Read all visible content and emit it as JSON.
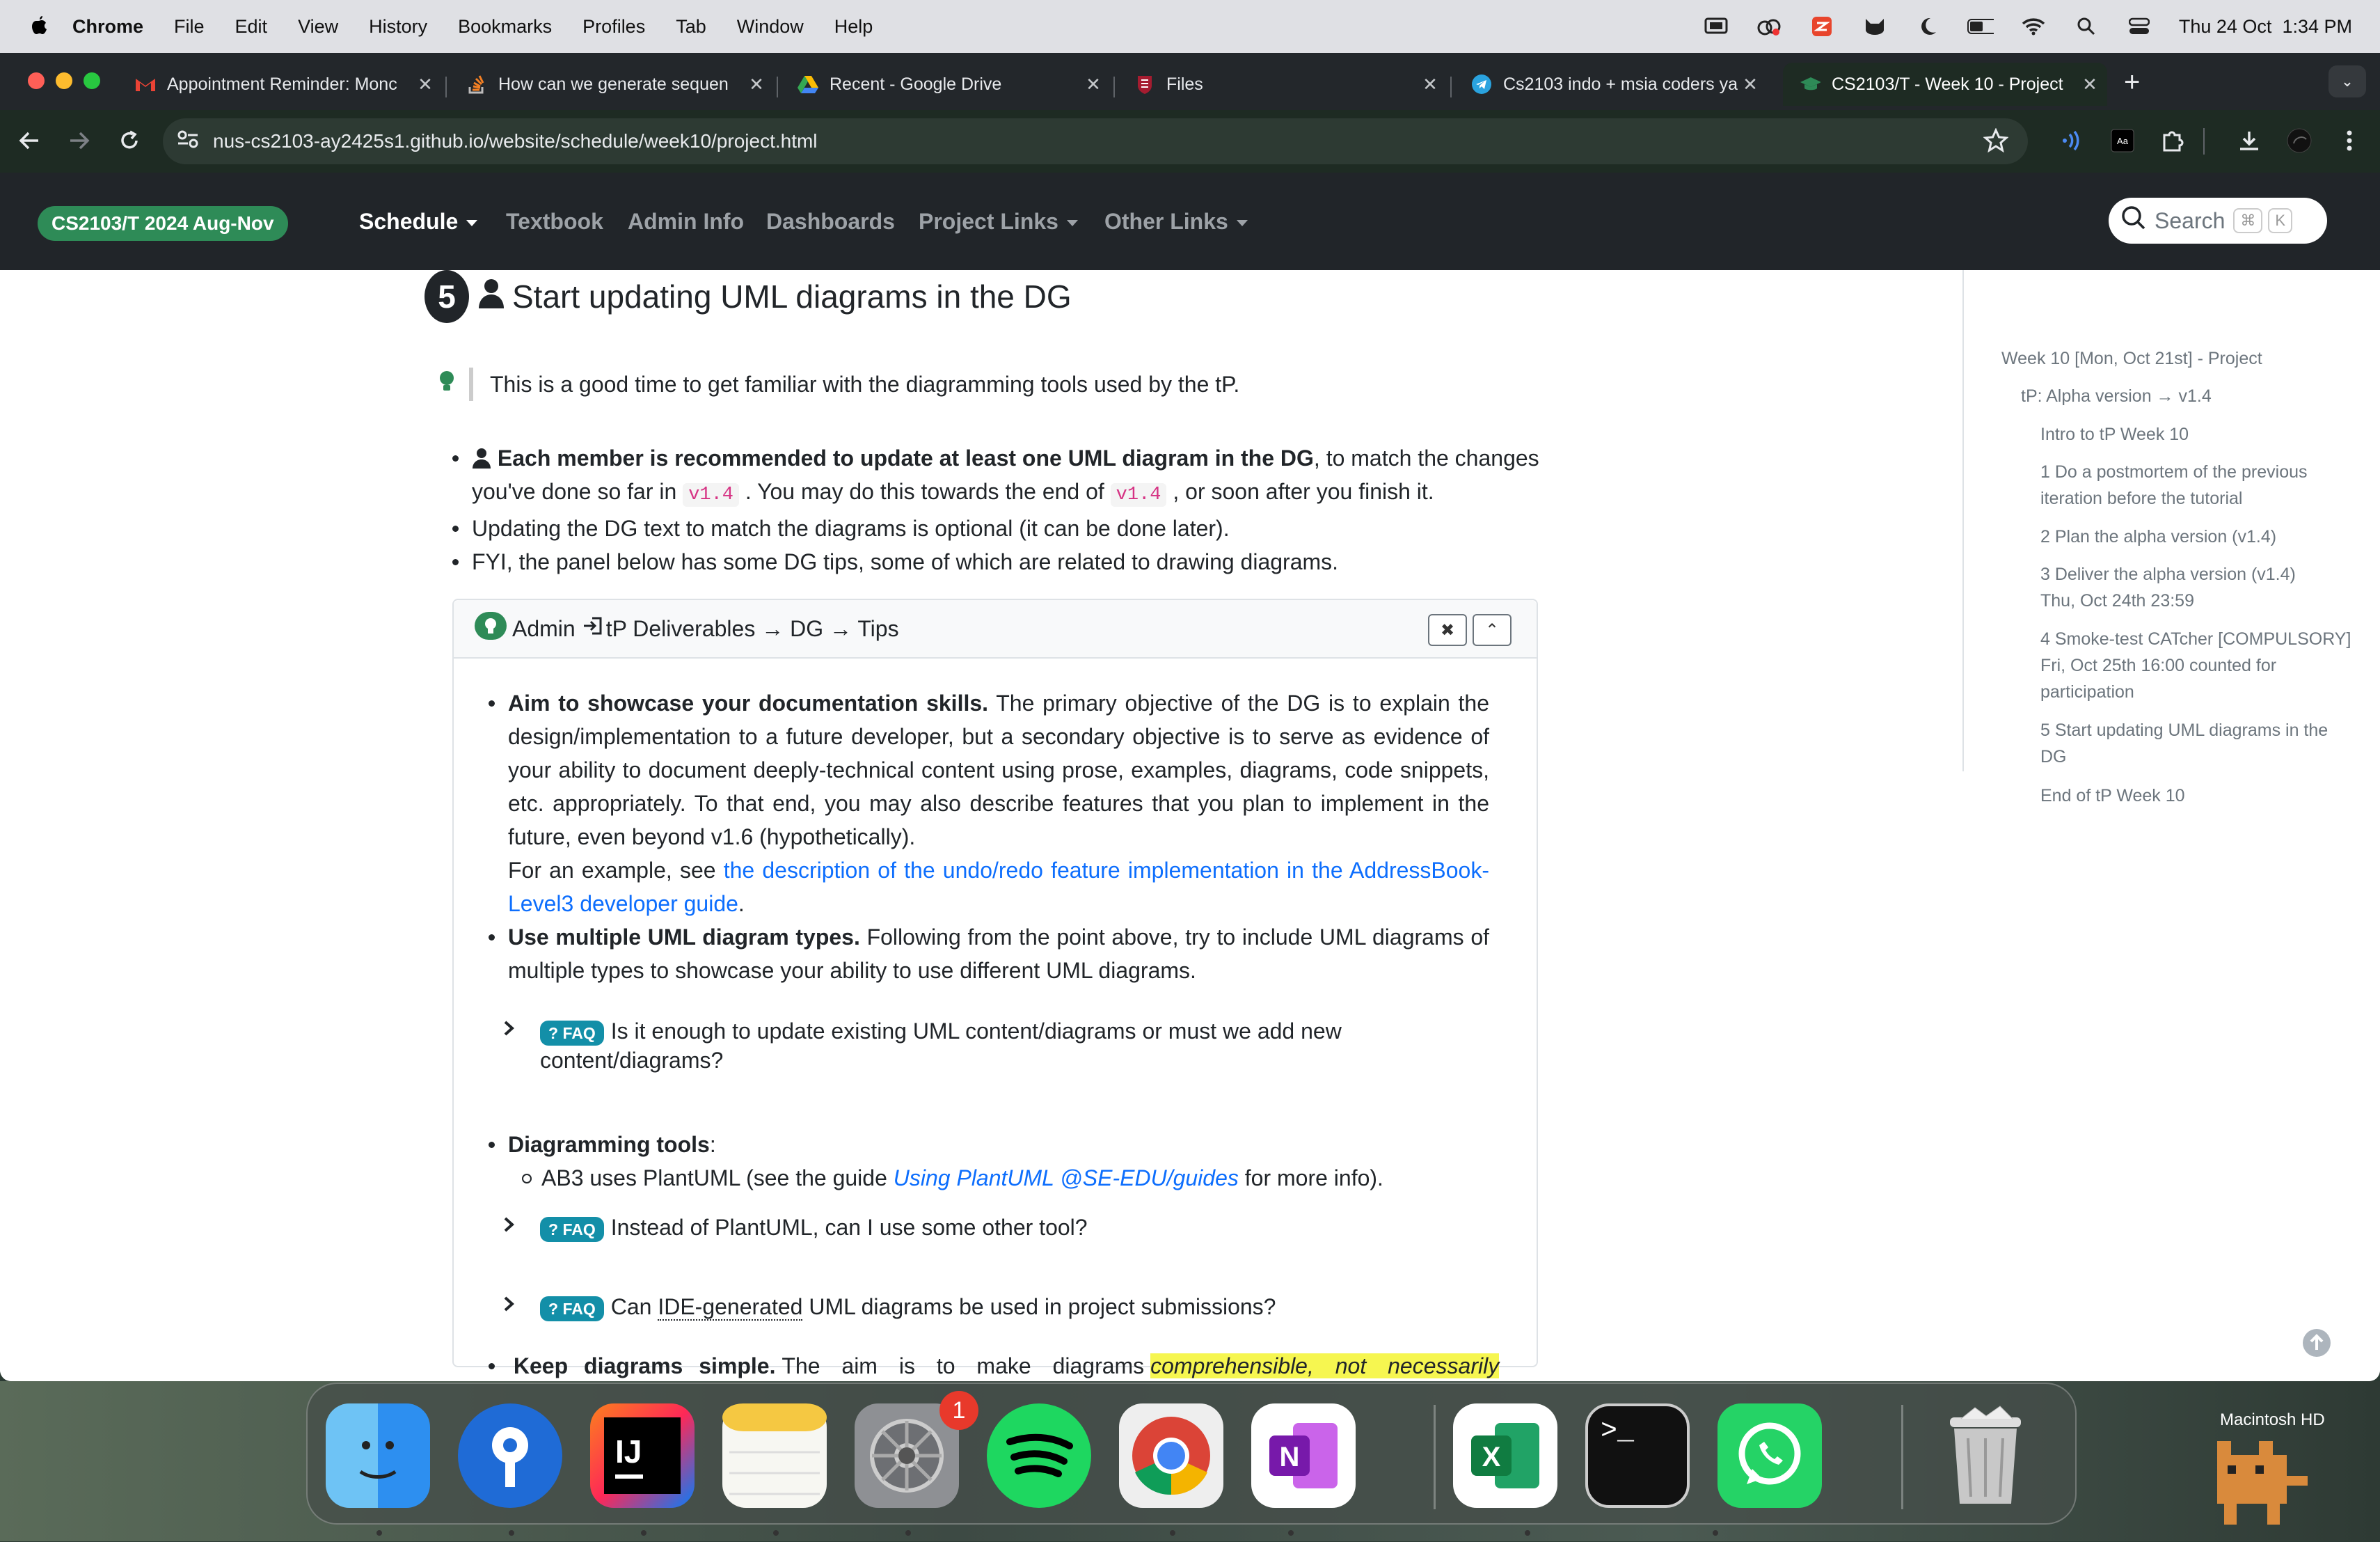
{
  "menubar": {
    "app": "Chrome",
    "items": [
      "File",
      "Edit",
      "View",
      "History",
      "Bookmarks",
      "Profiles",
      "Tab",
      "Window",
      "Help"
    ],
    "clock": "Thu 24 Oct  1:34 PM"
  },
  "tabs": [
    {
      "label": "Appointment Reminder: Monc",
      "favicon": "gmail-icon"
    },
    {
      "label": "How can we generate sequen",
      "favicon": "stackoverflow-icon"
    },
    {
      "label": "Recent - Google Drive",
      "favicon": "google-drive-icon"
    },
    {
      "label": "Files",
      "favicon": "files-icon"
    },
    {
      "label": "Cs2103 indo + msia coders ya",
      "favicon": "telegram-icon"
    },
    {
      "label": "CS2103/T - Week 10 - Project",
      "favicon": "course-icon",
      "active": true
    }
  ],
  "address": {
    "url": "nus-cs2103-ay2425s1.github.io/website/schedule/week10/project.html"
  },
  "site_nav": {
    "brand": "CS2103/T 2024 Aug-Nov",
    "links": [
      "Schedule",
      "Textbook",
      "Admin Info",
      "Dashboards",
      "Project Links",
      "Other Links"
    ],
    "search_label": "Search",
    "search_keys": [
      "⌘",
      "K"
    ]
  },
  "section": {
    "number": "5",
    "title": "Start updating UML diagrams in the DG",
    "tip": "This is a good time to get familiar with the diagramming tools used by the tP.",
    "bullet1_bold": "Each member is recommended to update at least one UML diagram in the DG",
    "bullet1_rest_a": ", to match the changes you've done so far in",
    "code1": "v1.4",
    "bullet1_rest_b": ". You may do this towards the end of",
    "code2": "v1.4",
    "bullet1_rest_c": ", or soon after you finish it.",
    "bullet2": "Updating the DG text to match the diagrams is optional (it can be done later).",
    "bullet3": "FYI, the panel below has some DG tips, some of which are related to drawing diagrams."
  },
  "panel": {
    "header_admin": "Admin",
    "header_path": "tP Deliverables → DG → Tips",
    "close_label": "✖",
    "collapse_label": "⌃",
    "p1_bold": "Aim to showcase your documentation skills.",
    "p1_text": "The primary objective of the DG is to explain the design/implementation to a future developer, but a secondary objective is to serve as evidence of your ability to document deeply-technical content using prose, examples, diagrams, code snippets, etc. appropriately. To that end, you may also describe features that you plan to implement in the future, even beyond v1.6 (hypothetically).",
    "p1_example_pre": "For an example, see",
    "p1_link": "the description of the undo/redo feature implementation in the AddressBook-Level3 developer guide",
    "p2_bold": "Use multiple UML diagram types.",
    "p2_text": "Following from the point above, try to include UML diagrams of multiple types to showcase your ability to use different UML diagrams.",
    "faq_badge": "? FAQ",
    "faq1": "Is it enough to update existing UML content/diagrams or must we add new content/diagrams?",
    "p3_bold": "Diagramming tools",
    "p3_sub_pre": "AB3 uses PlantUML (see the guide",
    "p3_sub_link": "Using PlantUML @SE-EDU/guides",
    "p3_sub_post": "for more info).",
    "faq2": "Instead of PlantUML, can I use some other tool?",
    "faq3_pre": "Can",
    "faq3_abbr": "IDE-generated",
    "faq3_post": "UML diagrams be used in project submissions?",
    "p4_bold": "Keep diagrams simple.",
    "p4_text": "The aim is to make diagrams",
    "p4_highlight": "comprehensible, not necessarily"
  },
  "toc": [
    "Week 10 [Mon, Oct 21st] - Project",
    "tP: Alpha version → v1.4",
    "Intro to tP Week 10",
    "1 Do a postmortem of the previous iteration before the tutorial",
    "2 Plan the alpha version (v1.4)",
    "3 Deliver the alpha version (v1.4) Thu, Oct 24th 23:59",
    "4 Smoke-test CATcher [COMPULSORY] Fri, Oct 25th 16:00 counted for participation",
    "5 Start updating UML diagrams in the DG",
    "End of tP Week 10"
  ],
  "dock": {
    "apps": [
      "finder-icon",
      "password-icon",
      "intellij-icon",
      "notes-icon",
      "system-settings-icon",
      "spotify-icon",
      "chrome-icon",
      "onenote-icon",
      "excel-icon",
      "terminal-icon",
      "whatsapp-icon",
      "trash-icon"
    ],
    "settings_badge": "1",
    "desktop_label": "Macintosh HD"
  },
  "colors": {
    "brand": "#2e8b57",
    "link": "#0d6efd",
    "faq": "#138fa8",
    "highlight": "#f6f650"
  }
}
